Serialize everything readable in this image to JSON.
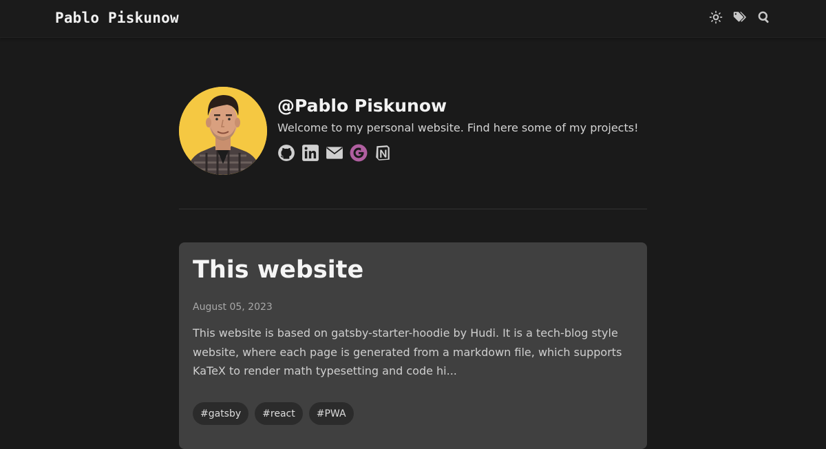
{
  "header": {
    "site_title": "Pablo Piskunow",
    "icons": [
      "sun-icon",
      "tags-icon",
      "search-icon"
    ]
  },
  "bio": {
    "name": "@Pablo Piskunow",
    "description": "Welcome to my personal website. Find here some of my projects!",
    "social_links": [
      "github-icon",
      "linkedin-icon",
      "email-icon",
      "google-scholar-icon",
      "notion-icon"
    ]
  },
  "post": {
    "title": "This website",
    "date": "August 05, 2023",
    "excerpt": "This website is based on gatsby-starter-hoodie by Hudi. It is a tech-blog style website, where each page is generated from a markdown file, which supports KaTeX to render math typesetting and code hi...",
    "tags": [
      "#gatsby",
      "#react",
      "#PWA"
    ]
  },
  "colors": {
    "background": "#1a1a1a",
    "card": "#404040",
    "tag_bg": "#2b2b2b",
    "avatar_bg": "#f5c842",
    "scholar_accent": "#b05fa0"
  }
}
